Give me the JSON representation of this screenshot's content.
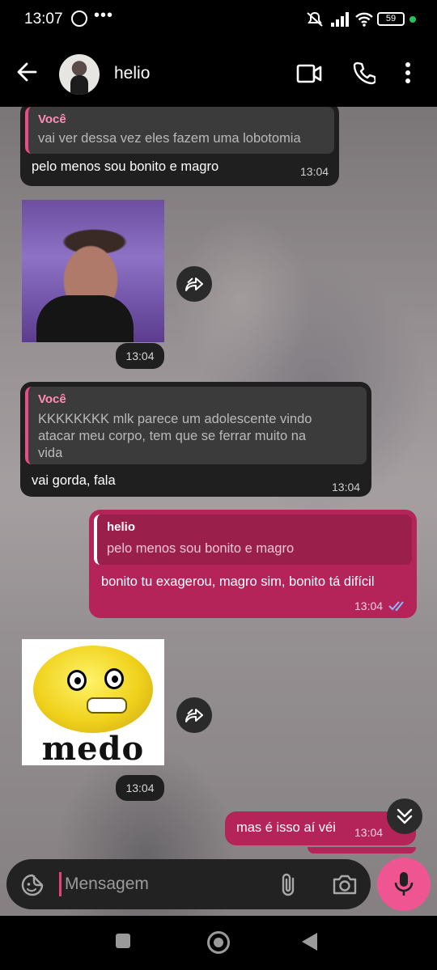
{
  "status_bar": {
    "time": "13:07",
    "dots": "•••",
    "battery": "59"
  },
  "header": {
    "contact_name": "helio"
  },
  "messages": [
    {
      "quote_author": "Você",
      "quote_text": "vai ver dessa vez eles fazem uma lobotomia",
      "text": "pelo menos sou bonito e magro",
      "time": "13:04"
    },
    {
      "time": "13:04"
    },
    {
      "quote_author": "Você",
      "quote_text_lines": [
        "KKKKKKKK mlk parece um adolescente vindo",
        "atacar meu corpo, tem que se ferrar muito na",
        "vida"
      ],
      "text": "vai gorda, fala",
      "time": "13:04"
    },
    {
      "quote_author": "helio",
      "quote_text": "pelo menos sou bonito e magro",
      "text": "bonito tu exagerou, magro sim, bonito tá difícil",
      "time": "13:04"
    },
    {
      "sticker_label": "medo",
      "time": "13:04"
    },
    {
      "text": "mas é isso aí véi",
      "time": "13:04"
    }
  ],
  "composer": {
    "placeholder": "Mensagem"
  },
  "colors": {
    "outgoing": "#b52459",
    "incoming": "#1f1f1f",
    "accent": "#ef5691",
    "quote_bar": "#e94c86",
    "read_ticks": "#8fb8ff"
  },
  "icons": [
    "back-arrow-icon",
    "video-call-icon",
    "phone-icon",
    "more-vert-icon",
    "forward-icon",
    "double-check-icon",
    "chevron-double-down-icon",
    "sticker-icon",
    "attach-icon",
    "camera-icon",
    "mic-icon"
  ]
}
